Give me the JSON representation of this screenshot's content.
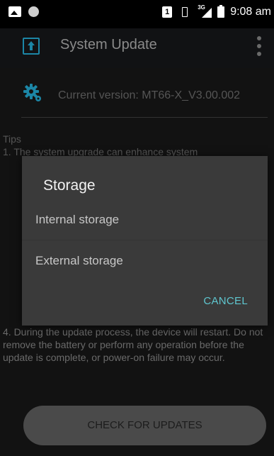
{
  "status_bar": {
    "sim_slot": "1",
    "network_type": "3G",
    "time": "9:08 am"
  },
  "app_bar": {
    "title": "System Update",
    "app_icon": "upload-icon",
    "menu_icon": "overflow-menu-icon"
  },
  "main": {
    "version_label": "Current version: MT66-X_V3.00.002",
    "version_icon": "gear-icon",
    "tips_title": "Tips",
    "tips_line1": "1. The system upgrade can enhance system",
    "tips_para4": "4. During the update process, the device will restart. Do not remove the battery or perform any operation before the update is complete, or power-on failure may occur.",
    "check_button": "CHECK FOR UPDATES"
  },
  "dialog": {
    "title": "Storage",
    "options": [
      "Internal storage",
      "External storage"
    ],
    "cancel_label": "CANCEL"
  },
  "colors": {
    "accent": "#5fc6cf",
    "app_icon": "#1c86a6",
    "dialog_bg": "#3a3a3a"
  }
}
